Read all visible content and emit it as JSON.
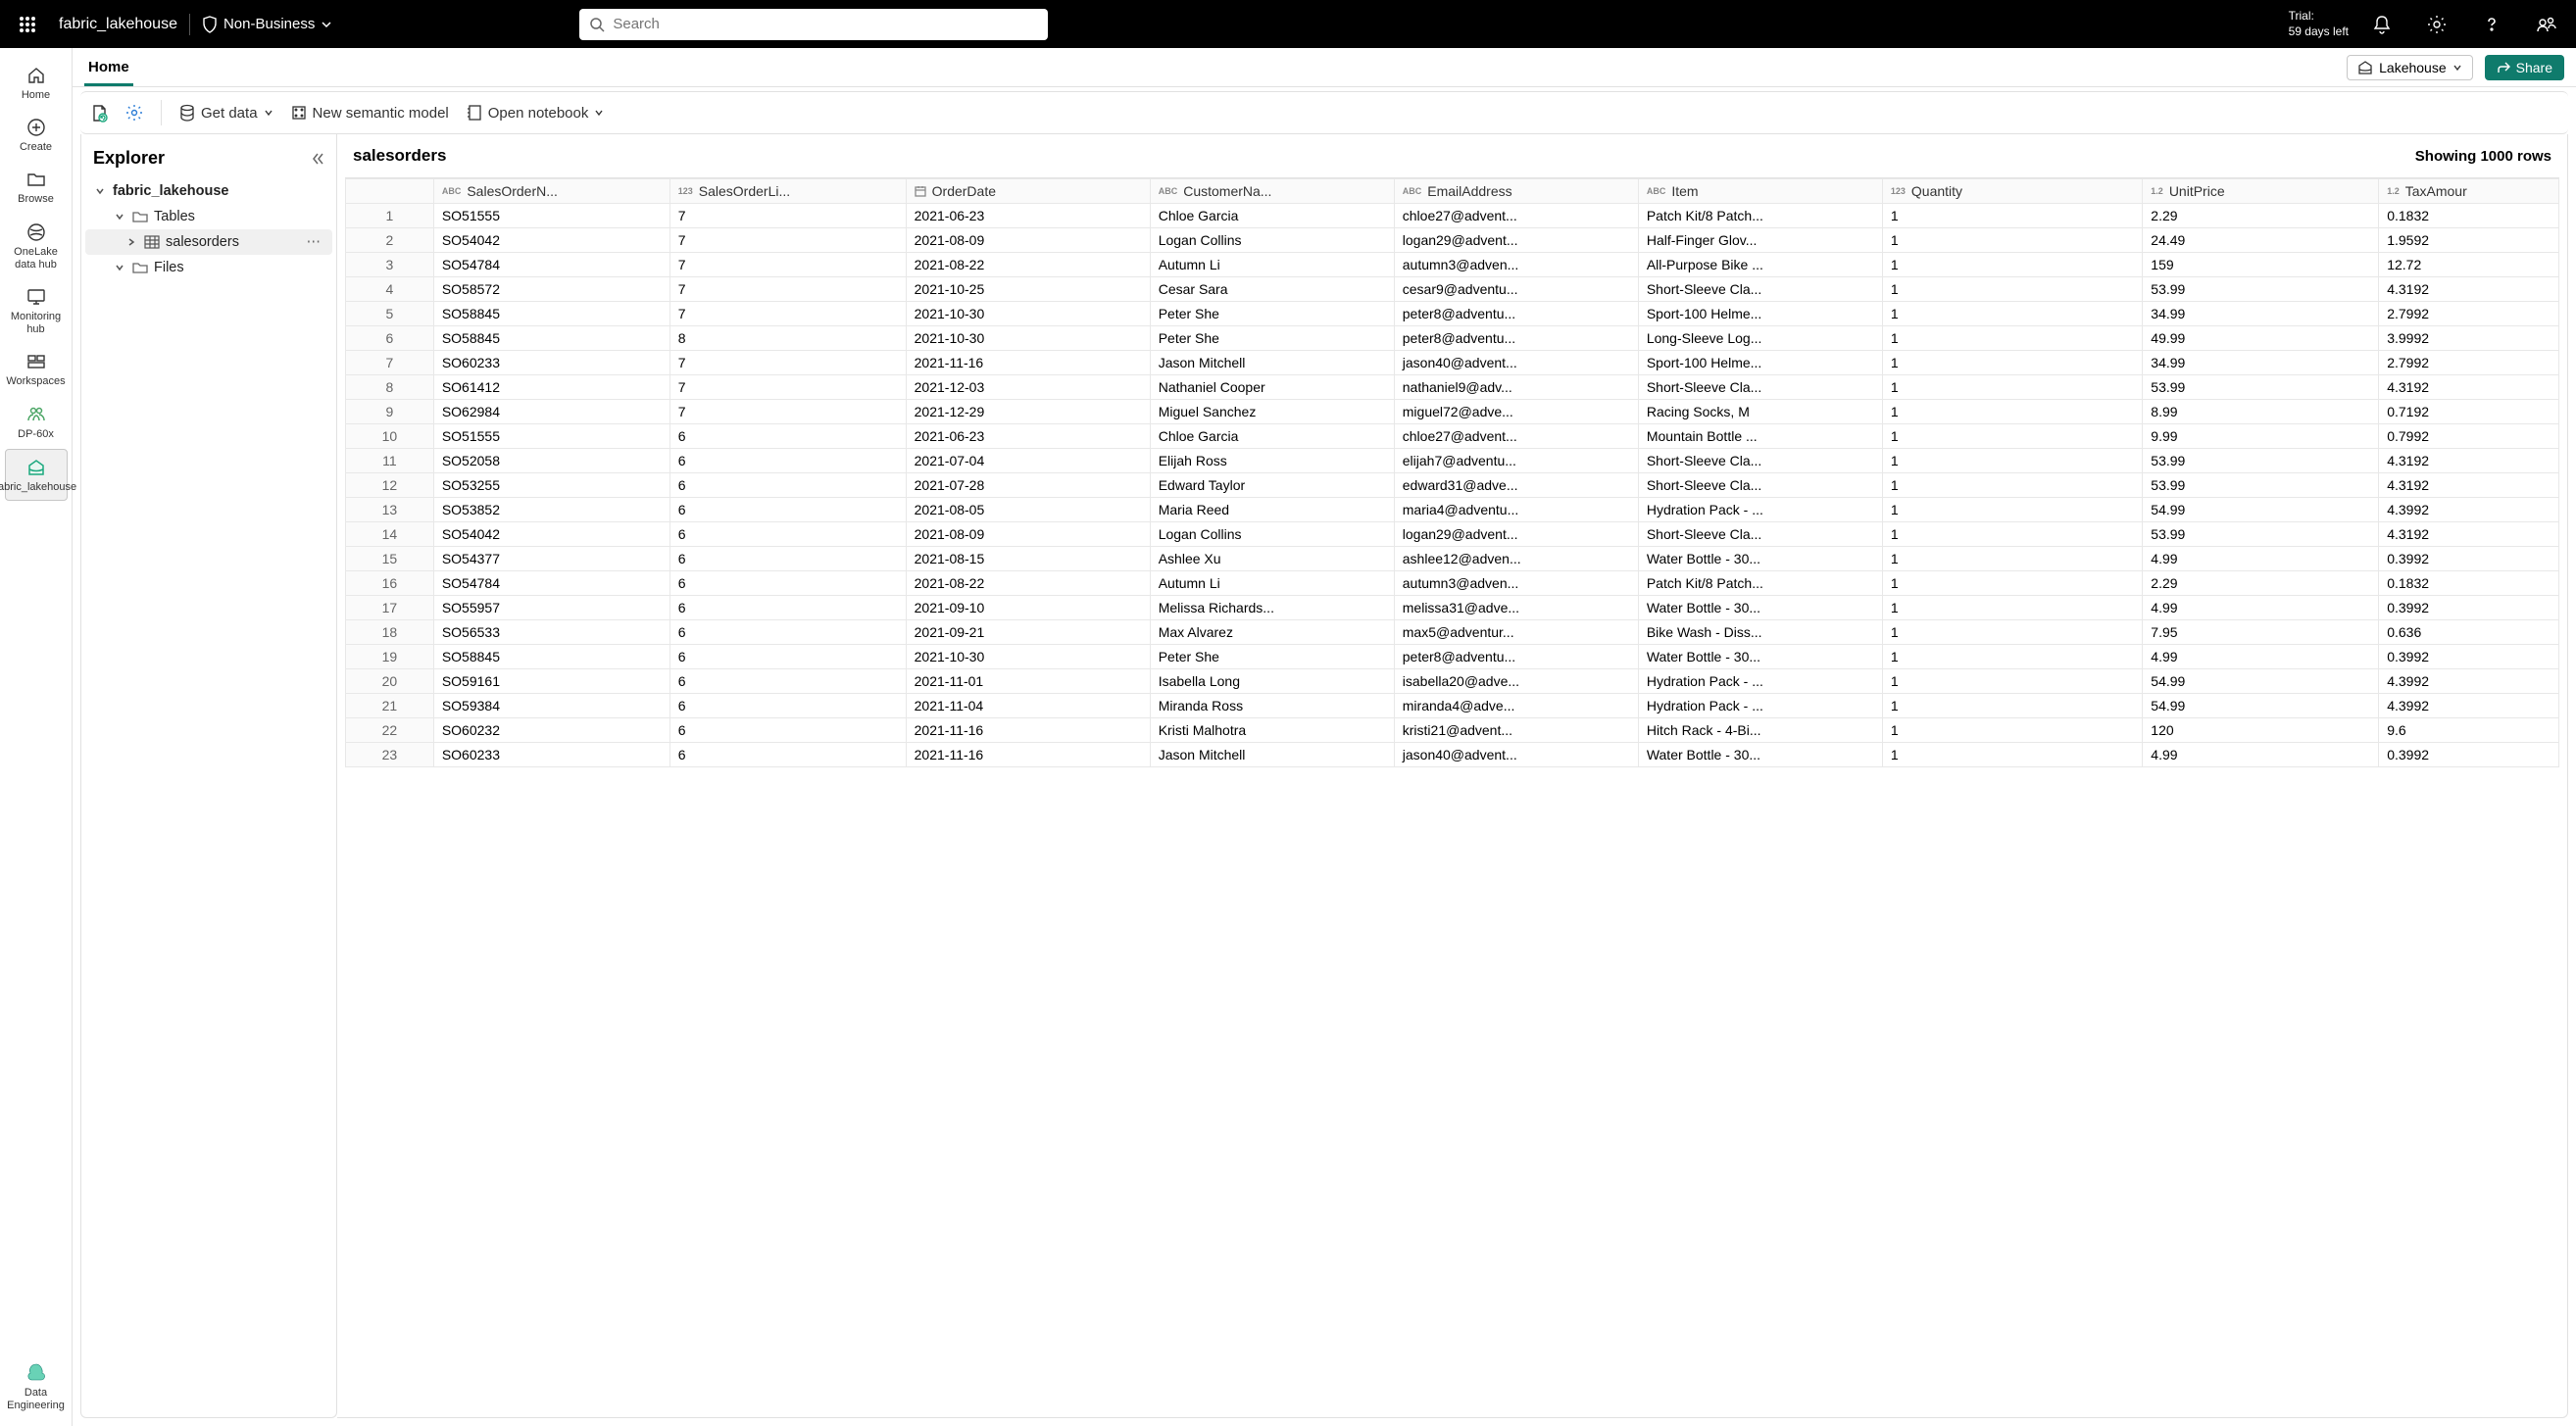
{
  "topbar": {
    "lakehouse_name": "fabric_lakehouse",
    "sensitivity_label": "Non-Business",
    "search_placeholder": "Search",
    "trial_line1": "Trial:",
    "trial_line2": "59 days left"
  },
  "rail": [
    {
      "label": "Home"
    },
    {
      "label": "Create"
    },
    {
      "label": "Browse"
    },
    {
      "label": "OneLake data hub"
    },
    {
      "label": "Monitoring hub"
    },
    {
      "label": "Workspaces"
    },
    {
      "label": "DP-60x"
    },
    {
      "label": "fabric_lakehouse"
    }
  ],
  "rail_bottom": {
    "label": "Data Engineering"
  },
  "tabs": {
    "home": "Home",
    "mode": "Lakehouse",
    "share": "Share"
  },
  "toolbar": {
    "get_data": "Get data",
    "semantic": "New semantic model",
    "notebook": "Open notebook"
  },
  "explorer": {
    "title": "Explorer",
    "root": "fabric_lakehouse",
    "tables": "Tables",
    "salesorders": "salesorders",
    "files": "Files"
  },
  "main": {
    "title": "salesorders",
    "rowcount": "Showing 1000 rows",
    "columns": [
      {
        "type": "ABC",
        "label": "SalesOrderN..."
      },
      {
        "type": "123",
        "label": "SalesOrderLi..."
      },
      {
        "type": "cal",
        "label": "OrderDate"
      },
      {
        "type": "ABC",
        "label": "CustomerNa..."
      },
      {
        "type": "ABC",
        "label": "EmailAddress"
      },
      {
        "type": "ABC",
        "label": "Item"
      },
      {
        "type": "123",
        "label": "Quantity"
      },
      {
        "type": "1.2",
        "label": "UnitPrice"
      },
      {
        "type": "1.2",
        "label": "TaxAmour"
      }
    ],
    "rows": [
      [
        "SO51555",
        "7",
        "2021-06-23",
        "Chloe Garcia",
        "chloe27@advent...",
        "Patch Kit/8 Patch...",
        "1",
        "2.29",
        "0.1832"
      ],
      [
        "SO54042",
        "7",
        "2021-08-09",
        "Logan Collins",
        "logan29@advent...",
        "Half-Finger Glov...",
        "1",
        "24.49",
        "1.9592"
      ],
      [
        "SO54784",
        "7",
        "2021-08-22",
        "Autumn Li",
        "autumn3@adven...",
        "All-Purpose Bike ...",
        "1",
        "159",
        "12.72"
      ],
      [
        "SO58572",
        "7",
        "2021-10-25",
        "Cesar Sara",
        "cesar9@adventu...",
        "Short-Sleeve Cla...",
        "1",
        "53.99",
        "4.3192"
      ],
      [
        "SO58845",
        "7",
        "2021-10-30",
        "Peter She",
        "peter8@adventu...",
        "Sport-100 Helme...",
        "1",
        "34.99",
        "2.7992"
      ],
      [
        "SO58845",
        "8",
        "2021-10-30",
        "Peter She",
        "peter8@adventu...",
        "Long-Sleeve Log...",
        "1",
        "49.99",
        "3.9992"
      ],
      [
        "SO60233",
        "7",
        "2021-11-16",
        "Jason Mitchell",
        "jason40@advent...",
        "Sport-100 Helme...",
        "1",
        "34.99",
        "2.7992"
      ],
      [
        "SO61412",
        "7",
        "2021-12-03",
        "Nathaniel Cooper",
        "nathaniel9@adv...",
        "Short-Sleeve Cla...",
        "1",
        "53.99",
        "4.3192"
      ],
      [
        "SO62984",
        "7",
        "2021-12-29",
        "Miguel Sanchez",
        "miguel72@adve...",
        "Racing Socks, M",
        "1",
        "8.99",
        "0.7192"
      ],
      [
        "SO51555",
        "6",
        "2021-06-23",
        "Chloe Garcia",
        "chloe27@advent...",
        "Mountain Bottle ...",
        "1",
        "9.99",
        "0.7992"
      ],
      [
        "SO52058",
        "6",
        "2021-07-04",
        "Elijah Ross",
        "elijah7@adventu...",
        "Short-Sleeve Cla...",
        "1",
        "53.99",
        "4.3192"
      ],
      [
        "SO53255",
        "6",
        "2021-07-28",
        "Edward Taylor",
        "edward31@adve...",
        "Short-Sleeve Cla...",
        "1",
        "53.99",
        "4.3192"
      ],
      [
        "SO53852",
        "6",
        "2021-08-05",
        "Maria Reed",
        "maria4@adventu...",
        "Hydration Pack - ...",
        "1",
        "54.99",
        "4.3992"
      ],
      [
        "SO54042",
        "6",
        "2021-08-09",
        "Logan Collins",
        "logan29@advent...",
        "Short-Sleeve Cla...",
        "1",
        "53.99",
        "4.3192"
      ],
      [
        "SO54377",
        "6",
        "2021-08-15",
        "Ashlee Xu",
        "ashlee12@adven...",
        "Water Bottle - 30...",
        "1",
        "4.99",
        "0.3992"
      ],
      [
        "SO54784",
        "6",
        "2021-08-22",
        "Autumn Li",
        "autumn3@adven...",
        "Patch Kit/8 Patch...",
        "1",
        "2.29",
        "0.1832"
      ],
      [
        "SO55957",
        "6",
        "2021-09-10",
        "Melissa Richards...",
        "melissa31@adve...",
        "Water Bottle - 30...",
        "1",
        "4.99",
        "0.3992"
      ],
      [
        "SO56533",
        "6",
        "2021-09-21",
        "Max Alvarez",
        "max5@adventur...",
        "Bike Wash - Diss...",
        "1",
        "7.95",
        "0.636"
      ],
      [
        "SO58845",
        "6",
        "2021-10-30",
        "Peter She",
        "peter8@adventu...",
        "Water Bottle - 30...",
        "1",
        "4.99",
        "0.3992"
      ],
      [
        "SO59161",
        "6",
        "2021-11-01",
        "Isabella Long",
        "isabella20@adve...",
        "Hydration Pack - ...",
        "1",
        "54.99",
        "4.3992"
      ],
      [
        "SO59384",
        "6",
        "2021-11-04",
        "Miranda Ross",
        "miranda4@adve...",
        "Hydration Pack - ...",
        "1",
        "54.99",
        "4.3992"
      ],
      [
        "SO60232",
        "6",
        "2021-11-16",
        "Kristi Malhotra",
        "kristi21@advent...",
        "Hitch Rack - 4-Bi...",
        "1",
        "120",
        "9.6"
      ],
      [
        "SO60233",
        "6",
        "2021-11-16",
        "Jason Mitchell",
        "jason40@advent...",
        "Water Bottle - 30...",
        "1",
        "4.99",
        "0.3992"
      ]
    ]
  }
}
